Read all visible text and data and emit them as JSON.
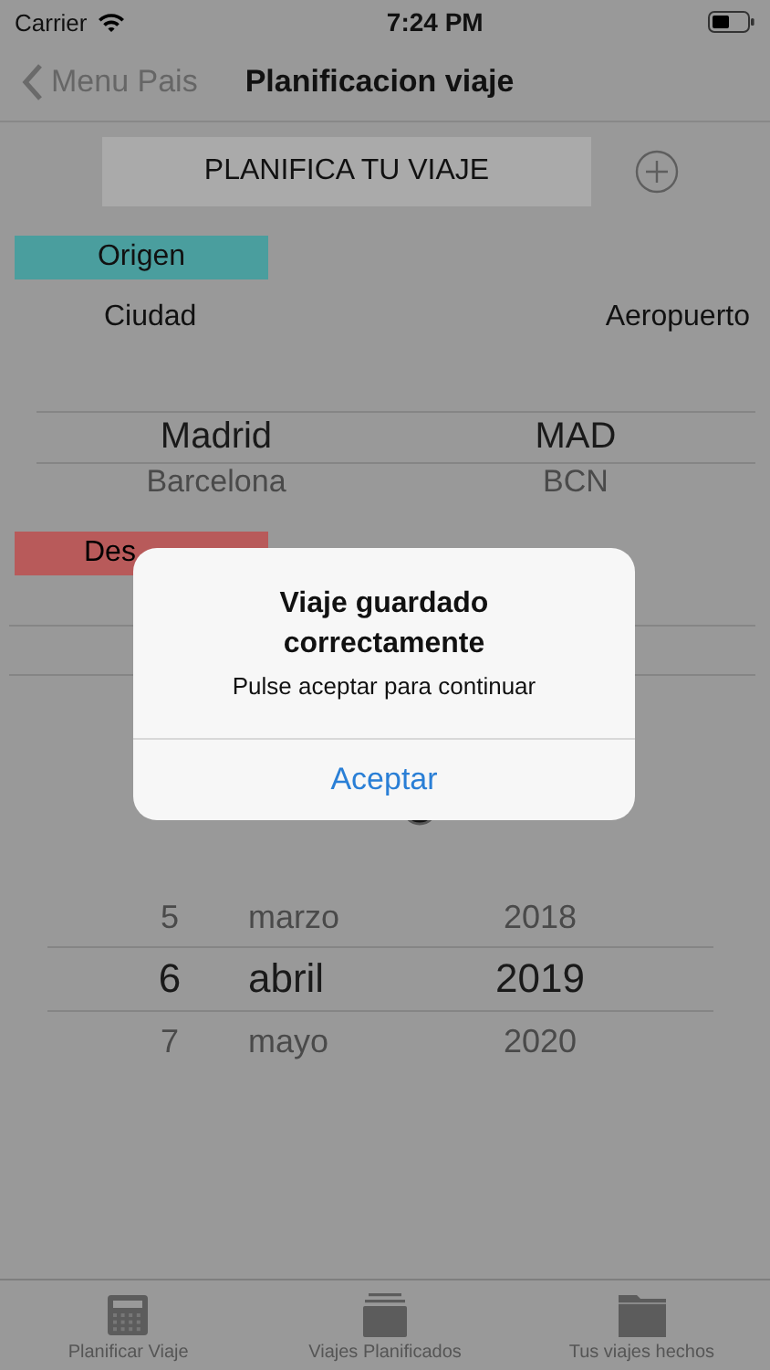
{
  "status_bar": {
    "carrier": "Carrier",
    "time": "7:24 PM"
  },
  "nav_bar": {
    "back": "Menu Pais",
    "title": "Planificacion viaje"
  },
  "plan_button": "PLANIFICA TU VIAJE",
  "origin": {
    "label": "Origen",
    "columns": [
      "Ciudad",
      "Aeropuerto"
    ],
    "rows": [
      {
        "city": "Madrid",
        "airport": "MAD",
        "selected": true
      },
      {
        "city": "Barcelona",
        "airport": "BCN",
        "selected": false
      }
    ]
  },
  "destination": {
    "label": "Des"
  },
  "date_picker": {
    "rows": [
      {
        "day": "5",
        "month": "marzo",
        "year": "2018",
        "selected": false
      },
      {
        "day": "6",
        "month": "abril",
        "year": "2019",
        "selected": true
      },
      {
        "day": "7",
        "month": "mayo",
        "year": "2020",
        "selected": false
      }
    ]
  },
  "alert": {
    "title": "Viaje guardado correctamente",
    "message": "Pulse aceptar para continuar",
    "button": "Aceptar"
  },
  "tab_bar": [
    {
      "label": "Planificar Viaje"
    },
    {
      "label": "Viajes Planificados"
    },
    {
      "label": "Tus viajes hechos"
    }
  ]
}
